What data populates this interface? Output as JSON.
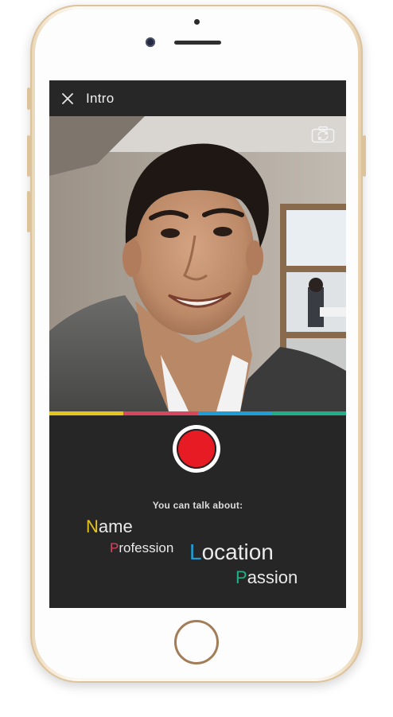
{
  "header": {
    "title": "Intro"
  },
  "icons": {
    "close": "close-icon",
    "switch_camera": "camera-switch-icon"
  },
  "progress_segments": [
    {
      "color": "#e6c41f"
    },
    {
      "color": "#d9465f"
    },
    {
      "color": "#1f9ed6"
    },
    {
      "color": "#1fae86"
    }
  ],
  "prompt": {
    "heading": "You can talk about:",
    "topics": [
      {
        "first": "N",
        "rest": "ame",
        "color": "#e6c41f"
      },
      {
        "first": "P",
        "rest": "rofession",
        "color": "#d9465f"
      },
      {
        "first": "L",
        "rest": "ocation",
        "color": "#1f9ed6"
      },
      {
        "first": "P",
        "rest": "assion",
        "color": "#1fae86"
      }
    ]
  },
  "colors": {
    "record": "#e71b24",
    "screen_bg": "#262626",
    "phone_frame": "#dcc39c"
  }
}
